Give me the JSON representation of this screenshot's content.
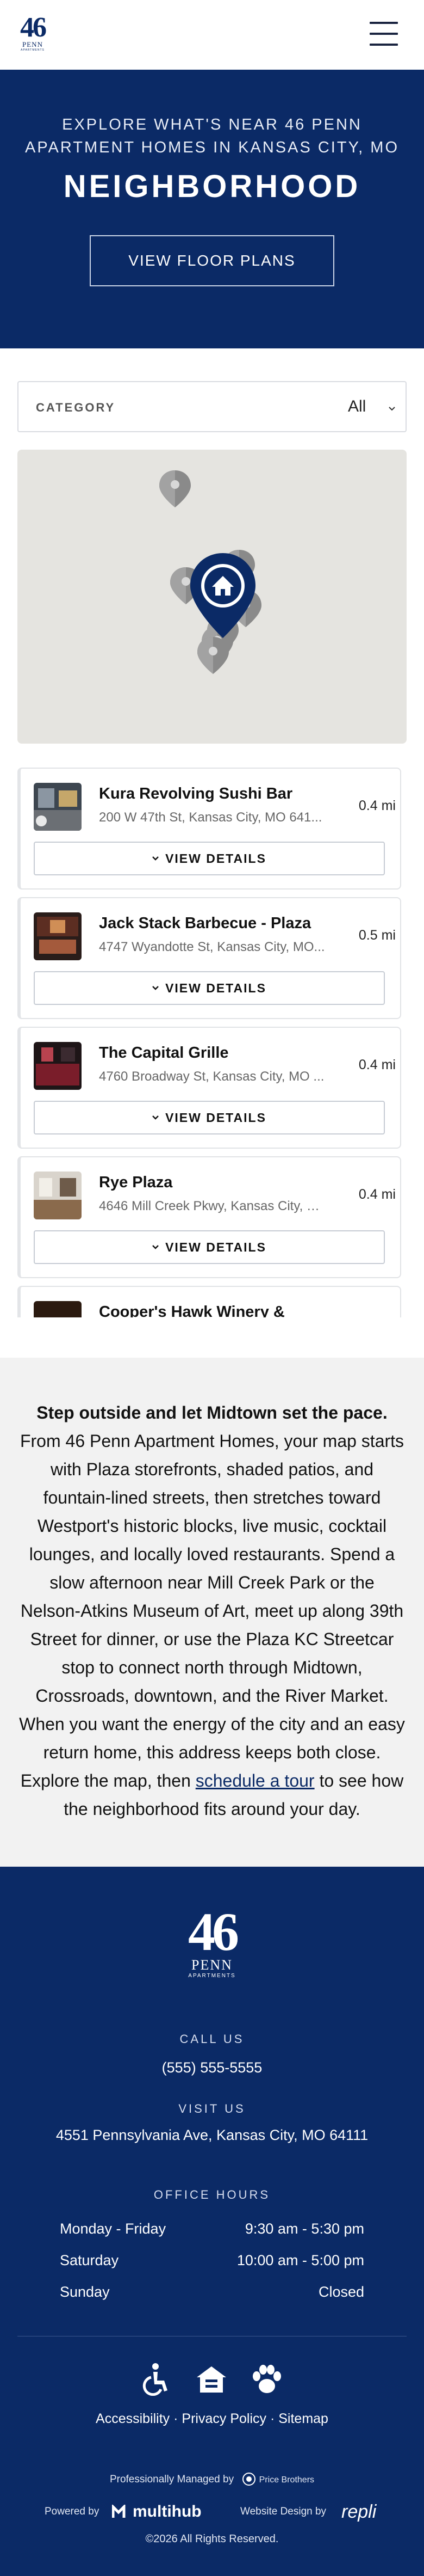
{
  "header": {
    "logo": {
      "number": "46",
      "name": "PENN",
      "tagline": "APARTMENTS"
    },
    "menu_icon": "hamburger-menu-icon"
  },
  "hero": {
    "kicker": "EXPLORE WHAT'S NEAR 46 PENN APARTMENT HOMES IN KANSAS CITY, MO",
    "title": "NEIGHBORHOOD",
    "cta_label": "VIEW FLOOR PLANS",
    "background_color": "#0b2a66"
  },
  "filter": {
    "label": "CATEGORY",
    "selected": "All",
    "icon": "chevron-down-icon"
  },
  "map": {
    "icons": [
      "map-pin-icon",
      "home-marker-icon"
    ]
  },
  "places": [
    {
      "name": "Kura Revolving Sushi Bar",
      "address": "200 W 47th St, Kansas City, MO 641...",
      "distance": "0.4 mi",
      "button": "VIEW DETAILS"
    },
    {
      "name": "Jack Stack Barbecue - Plaza",
      "address": "4747 Wyandotte St, Kansas City, MO...",
      "distance": "0.5 mi",
      "button": "VIEW DETAILS"
    },
    {
      "name": "The Capital Grille",
      "address": "4760 Broadway St, Kansas City, MO ...",
      "distance": "0.4 mi",
      "button": "VIEW DETAILS"
    },
    {
      "name": "Rye Plaza",
      "address": "4646 Mill Creek Pkwy, Kansas City, M...",
      "distance": "0.4 mi",
      "button": "VIEW DETAILS"
    },
    {
      "name": "Cooper's Hawk Winery &",
      "address": "",
      "distance": "",
      "button": ""
    }
  ],
  "about": {
    "lead": "Step outside and let Midtown set the pace.",
    "body": "From 46 Penn Apartment Homes, your map starts with Plaza storefronts, shaded patios, and fountain-lined streets, then stretches toward Westport's historic blocks, live music, cocktail lounges, and locally loved restaurants. Spend a slow afternoon near Mill Creek Park or the Nelson-Atkins Museum of Art, meet up along 39th Street for dinner, or use the Plaza KC Streetcar stop to connect north through Midtown, Crossroads, downtown, and the River Market. When you want the energy of the city and an easy return home, this address keeps both close. Explore the map, then",
    "link": "schedule a tour",
    "tail": "to see how the neighborhood fits around your day."
  },
  "footer": {
    "logo": {
      "number": "46",
      "name": "PENN",
      "tagline": "APARTMENTS"
    },
    "call_label": "CALL US",
    "phone": "(555) 555-5555",
    "visit_label": "VISIT US",
    "address": "4551 Pennsylvania Ave, Kansas City, MO 64111",
    "hours_label": "OFFICE HOURS",
    "hours": [
      {
        "day": "Monday - Friday",
        "time": "9:30 am - 5:30 pm"
      },
      {
        "day": "Saturday",
        "time": "10:00 am - 5:00 pm"
      },
      {
        "day": "Sunday",
        "time": "Closed"
      }
    ],
    "icons": [
      "accessibility-icon",
      "equal-housing-icon",
      "pet-paw-icon"
    ],
    "links": [
      "Accessibility",
      "Privacy Policy",
      "Sitemap"
    ],
    "separator": "·",
    "managed_text": "Professionally Managed by",
    "managed_brand": "Price Brothers",
    "powered_text": "Powered by",
    "powered_brand": "multihub",
    "design_text": "Website Design by",
    "design_brand": "repli",
    "copyright": "©2026 All Rights Reserved."
  }
}
